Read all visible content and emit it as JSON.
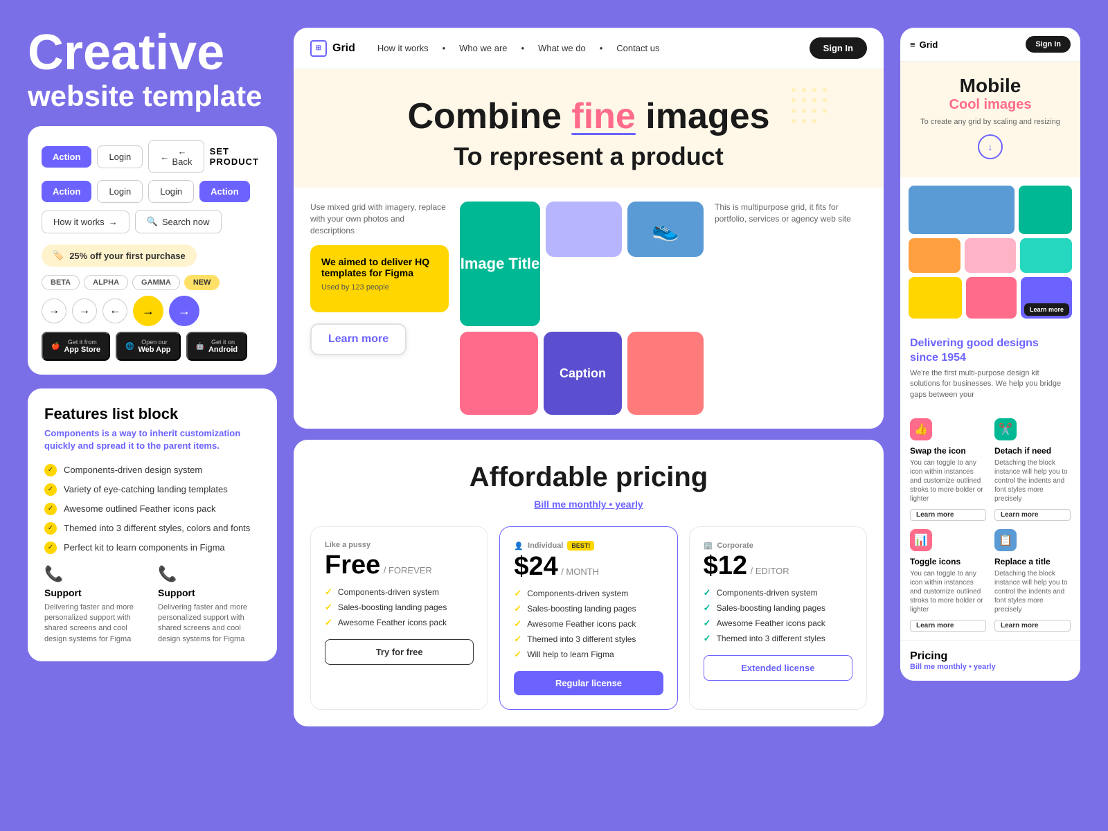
{
  "page": {
    "background_color": "#7B6FE8"
  },
  "left": {
    "hero_title": "Creative",
    "hero_subtitle": "website template",
    "ui_kit_card": {
      "buttons": [
        {
          "label": "Action",
          "style": "purple"
        },
        {
          "label": "Login",
          "style": "outline"
        },
        {
          "label": "← Back",
          "style": "outline"
        },
        {
          "label": "SET PRODUCT",
          "style": "brand"
        }
      ],
      "buttons_row2": [
        {
          "label": "Action",
          "style": "purple"
        },
        {
          "label": "Login",
          "style": "outline"
        },
        {
          "label": "Login",
          "style": "outline"
        },
        {
          "label": "Action",
          "style": "purple"
        }
      ],
      "how_it_works": "How it works",
      "search_now": "Search now",
      "promo_badge": "25% off your first purchase",
      "tags": [
        "BETA",
        "ALPHA",
        "GAMMA",
        "NEW"
      ],
      "stores": [
        {
          "icon": "🍎",
          "line1": "Get it from",
          "line2": "App Store"
        },
        {
          "icon": "🌐",
          "line1": "Open our",
          "line2": "Web App"
        },
        {
          "icon": "🤖",
          "line1": "Get it on",
          "line2": "Android"
        }
      ]
    },
    "features_card": {
      "title": "Features list block",
      "subtitle": "Components is a way to inherit customization quickly and spread it to the parent items.",
      "items": [
        "Components-driven design system",
        "Variety of eye-catching landing templates",
        "Awesome outlined Feather icons pack",
        "Themed into 3 different styles, colors and fonts",
        "Perfect kit to learn components in Figma"
      ],
      "support": [
        {
          "title": "Support",
          "description": "Delivering faster and more personalized support with shared screens and cool design systems for Figma"
        },
        {
          "title": "Support",
          "description": "Delivering faster and more personalized support with shared screens and cool design systems for Figma"
        }
      ]
    }
  },
  "middle": {
    "nav": {
      "logo": "Grid",
      "links": [
        "How it works",
        "Who we are",
        "What we do",
        "Contact us"
      ],
      "sign_in": "Sign In"
    },
    "hero": {
      "line1_pre": "Combine ",
      "line1_highlight": "fine",
      "line1_post": " images",
      "line2": "To represent a product"
    },
    "grid_section": {
      "left_text": "Use mixed grid with imagery, replace with your own photos and descriptions",
      "promo": {
        "title": "We aimed to deliver HQ templates for Figma",
        "subtitle": "Used by 123 people"
      },
      "image_title": "Image Title",
      "caption": "Caption",
      "right_text": "This is multipurpose grid, it fits for portfolio, services or agency web site"
    },
    "learn_more": "Learn more",
    "pricing": {
      "title": "Affordable pricing",
      "billing_text": "Bill me ",
      "billing_monthly": "monthly",
      "billing_separator": " • yearly",
      "plans": [
        {
          "badge": "Like a pussy",
          "name": "Free",
          "period": "/ FOREVER",
          "features": [
            "Components-driven system",
            "Sales-boosting landing pages",
            "Awesome Feather icons pack"
          ],
          "btn": "Try for free",
          "btn_style": "outline"
        },
        {
          "badge": "Individual",
          "best": "BEST!",
          "name": "$24",
          "period": "/ MONTH",
          "features": [
            "Components-driven system",
            "Sales-boosting landing pages",
            "Awesome Feather icons pack",
            "Themed into 3 different styles",
            "Will help to learn Figma"
          ],
          "btn": "Regular license",
          "btn_style": "purple"
        },
        {
          "badge": "Corporate",
          "name": "$12",
          "period": "/ EDITOR",
          "features": [
            "Components-driven system",
            "Sales-boosting landing pages",
            "Awesome Feather icons pack",
            "Themed into 3 different styles"
          ],
          "btn": "Extended license",
          "btn_style": "outline-purple"
        }
      ]
    }
  },
  "right": {
    "nav": {
      "logo": "Grid",
      "sign_in": "Sign In"
    },
    "hero": {
      "title1": "Mobile",
      "title2": "Cool images",
      "subtitle": "To create any grid by scaling and resizing"
    },
    "learn_more": "Learn more",
    "info": {
      "title1": "Delivering good designs",
      "title2": "since 1954",
      "description": "We're the first multi-purpose design kit solutions for businesses. We help you bridge gaps between   your"
    },
    "features": [
      {
        "icon": "👍",
        "icon_bg": "red",
        "title": "Swap the icon",
        "description": "You can toggle to any icon within instances and customize outlined stroks to more bolder or lighter",
        "learn_more": "Learn more"
      },
      {
        "icon": "✂️",
        "icon_bg": "green",
        "title": "Detach if need",
        "description": "Detaching the block instance will help you to control the indents and font styles more precisely",
        "learn_more": "Learn more"
      },
      {
        "icon": "📊",
        "icon_bg": "pink",
        "title": "Toggle icons",
        "description": "You can toggle to any icon within instances and customize outlined stroks to more bolder or lighter",
        "learn_more": "Learn more"
      },
      {
        "icon": "📋",
        "icon_bg": "blue",
        "title": "Replace a title",
        "description": "Detaching the block instance will help you to control the indents and font styles more precisely",
        "learn_more": "Learn more"
      }
    ],
    "pricing": {
      "title": "Pricing",
      "billing_text": "Bill me monthly • ",
      "billing_highlight": "yearly"
    }
  }
}
